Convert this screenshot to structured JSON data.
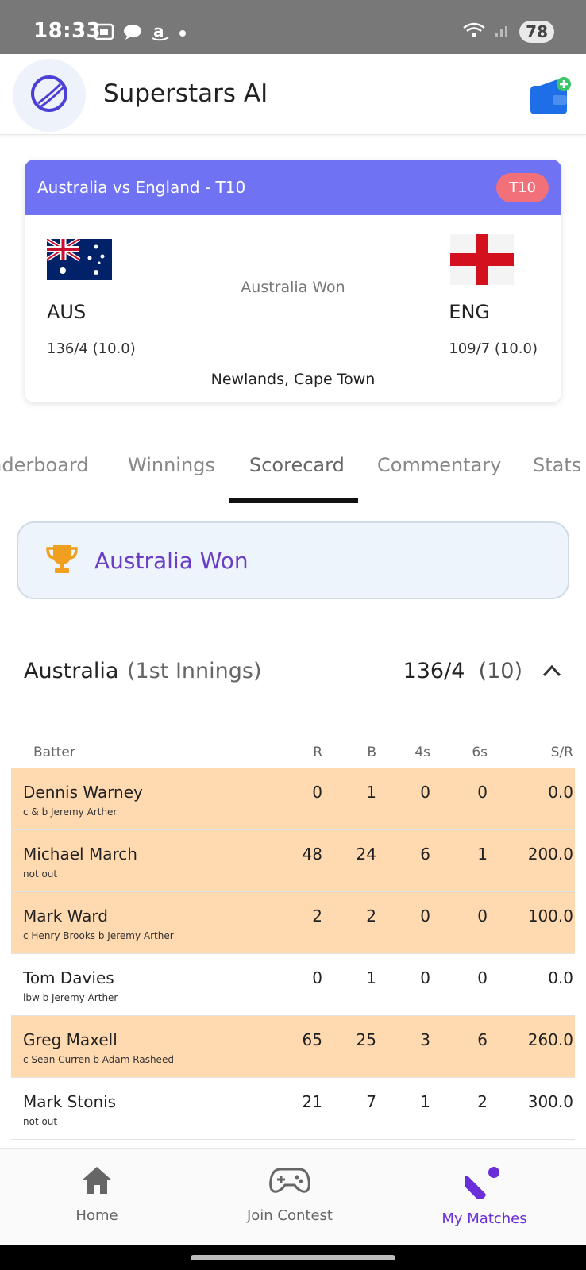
{
  "status_bar": {
    "time": "18:33",
    "battery": "78"
  },
  "app": {
    "title": "Superstars AI"
  },
  "match": {
    "title": "Australia vs England - T10",
    "format": "T10",
    "status": "Australia Won",
    "venue": "Newlands, Cape Town",
    "team1": {
      "code": "AUS",
      "score": "136/4 (10.0)"
    },
    "team2": {
      "code": "ENG",
      "score": "109/7 (10.0)"
    }
  },
  "tabs": [
    {
      "label": "Leaderboard"
    },
    {
      "label": "Winnings"
    },
    {
      "label": "Scorecard"
    },
    {
      "label": "Commentary"
    },
    {
      "label": "Stats"
    }
  ],
  "active_tab": "Scorecard",
  "result_banner": {
    "text": "Australia Won"
  },
  "innings": {
    "team": "Australia",
    "label": "(1st Innings)",
    "score": "136/4",
    "overs": "(10)"
  },
  "table": {
    "headers": {
      "batter": "Batter",
      "r": "R",
      "b": "B",
      "fours": "4s",
      "sixes": "6s",
      "sr": "S/R"
    },
    "rows": [
      {
        "name": "Dennis Warney",
        "dismissal": "c & b Jeremy Arther",
        "r": "0",
        "b": "1",
        "fours": "0",
        "sixes": "0",
        "sr": "0.0",
        "highlight": true
      },
      {
        "name": "Michael March",
        "dismissal": "not out",
        "r": "48",
        "b": "24",
        "fours": "6",
        "sixes": "1",
        "sr": "200.0",
        "highlight": true
      },
      {
        "name": "Mark Ward",
        "dismissal": "c Henry Brooks b Jeremy Arther",
        "r": "2",
        "b": "2",
        "fours": "0",
        "sixes": "0",
        "sr": "100.0",
        "highlight": true
      },
      {
        "name": "Tom Davies",
        "dismissal": "lbw b Jeremy Arther",
        "r": "0",
        "b": "1",
        "fours": "0",
        "sixes": "0",
        "sr": "0.0",
        "highlight": false
      },
      {
        "name": "Greg Maxell",
        "dismissal": "c Sean Curren b Adam Rasheed",
        "r": "65",
        "b": "25",
        "fours": "3",
        "sixes": "6",
        "sr": "260.0",
        "highlight": true
      },
      {
        "name": "Mark Stonis",
        "dismissal": "not out",
        "r": "21",
        "b": "7",
        "fours": "1",
        "sixes": "2",
        "sr": "300.0",
        "highlight": false
      }
    ]
  },
  "bottom_nav": [
    {
      "label": "Home",
      "icon": "home-icon"
    },
    {
      "label": "Join Contest",
      "icon": "gamepad-icon"
    },
    {
      "label": "My Matches",
      "icon": "cricket-bat-icon",
      "active": true
    }
  ],
  "colors": {
    "header_accent": "#6e72f3",
    "badge": "#f2707a",
    "highlight_row": "#ffd9b0",
    "active_nav": "#6a2fd8",
    "result_text": "#6a3fc6"
  }
}
